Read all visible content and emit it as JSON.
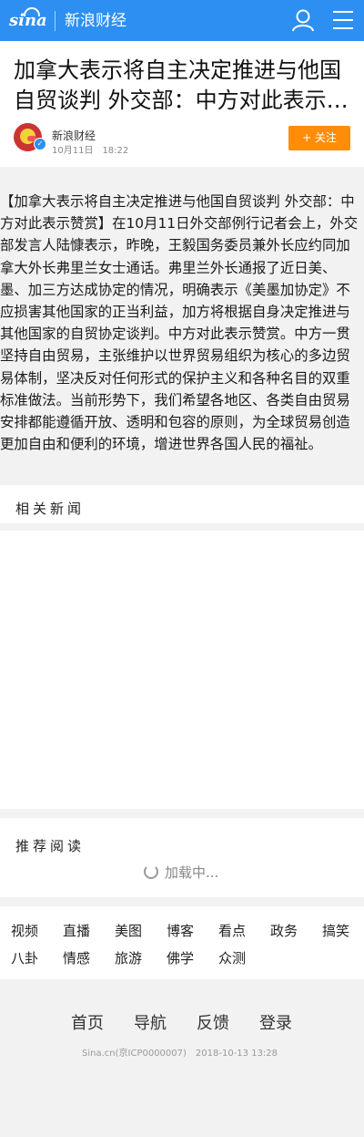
{
  "header": {
    "logo_text": "sina",
    "channel": "新浪财经"
  },
  "article": {
    "title": "加拿大表示将自主决定推进与他国自贸谈判 外交部：中方对此表示…",
    "author": "新浪财经",
    "time": "10月11日　18:22",
    "follow_label": "+ 关注",
    "body": "【加拿大表示将自主决定推进与他国自贸谈判 外交部：中方对此表示赞赏】在10月11日外交部例行记者会上，外交部发言人陆慷表示，昨晚，王毅国务委员兼外长应约同加拿大外长弗里兰女士通话。弗里兰外长通报了近日美、墨、加三方达成协定的情况，明确表示《美墨加协定》不应损害其他国家的正当利益，加方将根据自身决定推进与其他国家的自贸协定谈判。中方对此表示赞赏。中方一贯坚持自由贸易，主张维护以世界贸易组织为核心的多边贸易体制，坚决反对任何形式的保护主义和各种名目的双重标准做法。当前形势下，我们希望各地区、各类自由贸易安排都能遵循开放、透明和包容的原则，为全球贸易创造更加自由和便利的环境，增进世界各国人民的福祉。"
  },
  "related": {
    "title": "相关新闻"
  },
  "recommend": {
    "title": "推荐阅读",
    "loading": "加载中..."
  },
  "categories": [
    "视频",
    "直播",
    "美图",
    "博客",
    "看点",
    "政务",
    "搞笑",
    "八卦",
    "情感",
    "旅游",
    "佛学",
    "众测"
  ],
  "footer": {
    "links": [
      "首页",
      "导航",
      "反馈",
      "登录"
    ],
    "meta": "Sina.cn(京ICP0000007)　2018-10-13 13:28"
  },
  "colors": {
    "brand_blue": "#2d8ff1",
    "follow_orange": "#ff8d0a",
    "page_bg": "#f2f2f2"
  },
  "icons": [
    "sina-logo-icon",
    "user-icon",
    "menu-icon",
    "verified-icon",
    "loading-spinner-icon"
  ]
}
